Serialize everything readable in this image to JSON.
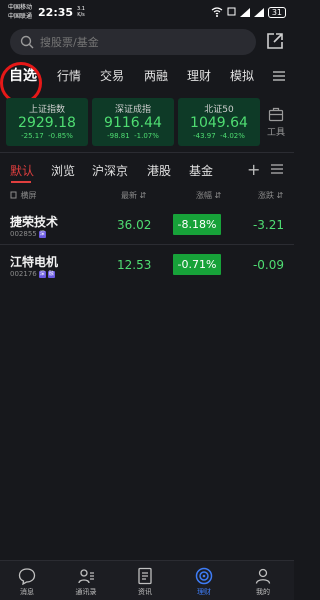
{
  "status": {
    "carrier1": "中国移动",
    "carrier2": "中国联通",
    "time": "22:35",
    "netspeed_value": "3.1",
    "netspeed_unit": "K/s",
    "battery": "31"
  },
  "search": {
    "placeholder": "搜股票/基金"
  },
  "top_tabs": [
    {
      "label": "自选",
      "active": true
    },
    {
      "label": "行情"
    },
    {
      "label": "交易"
    },
    {
      "label": "两融"
    },
    {
      "label": "理财"
    },
    {
      "label": "模拟"
    }
  ],
  "indices": [
    {
      "name": "上证指数",
      "value": "2929.18",
      "change": "-25.17",
      "pct": "-0.85%"
    },
    {
      "name": "深证成指",
      "value": "9116.44",
      "change": "-98.81",
      "pct": "-1.07%"
    },
    {
      "name": "北证50",
      "value": "1049.64",
      "change": "-43.97",
      "pct": "-4.02%"
    }
  ],
  "tool_label": "工具",
  "watch_tabs": [
    {
      "label": "默认",
      "active": true
    },
    {
      "label": "浏览"
    },
    {
      "label": "沪深京"
    },
    {
      "label": "港股"
    },
    {
      "label": "基金"
    }
  ],
  "header": {
    "landscape": "横屏",
    "price": "最新",
    "pct": "涨幅",
    "diff": "涨跌"
  },
  "stocks": [
    {
      "name": "捷荣技术",
      "code": "002855",
      "tags": [
        "深"
      ],
      "price": "36.02",
      "pct": "-8.18%",
      "diff": "-3.21"
    },
    {
      "name": "江特电机",
      "code": "002176",
      "tags": [
        "深",
        "融"
      ],
      "price": "12.53",
      "pct": "-0.71%",
      "diff": "-0.09"
    }
  ],
  "bottom_nav": [
    {
      "label": "消息"
    },
    {
      "label": "通讯录"
    },
    {
      "label": "资讯"
    },
    {
      "label": "理财",
      "active": true
    },
    {
      "label": "我的"
    }
  ],
  "colors": {
    "down_green": "#4fdd72",
    "accent_red": "#e03f3f",
    "nav_active": "#3e7cf6"
  }
}
